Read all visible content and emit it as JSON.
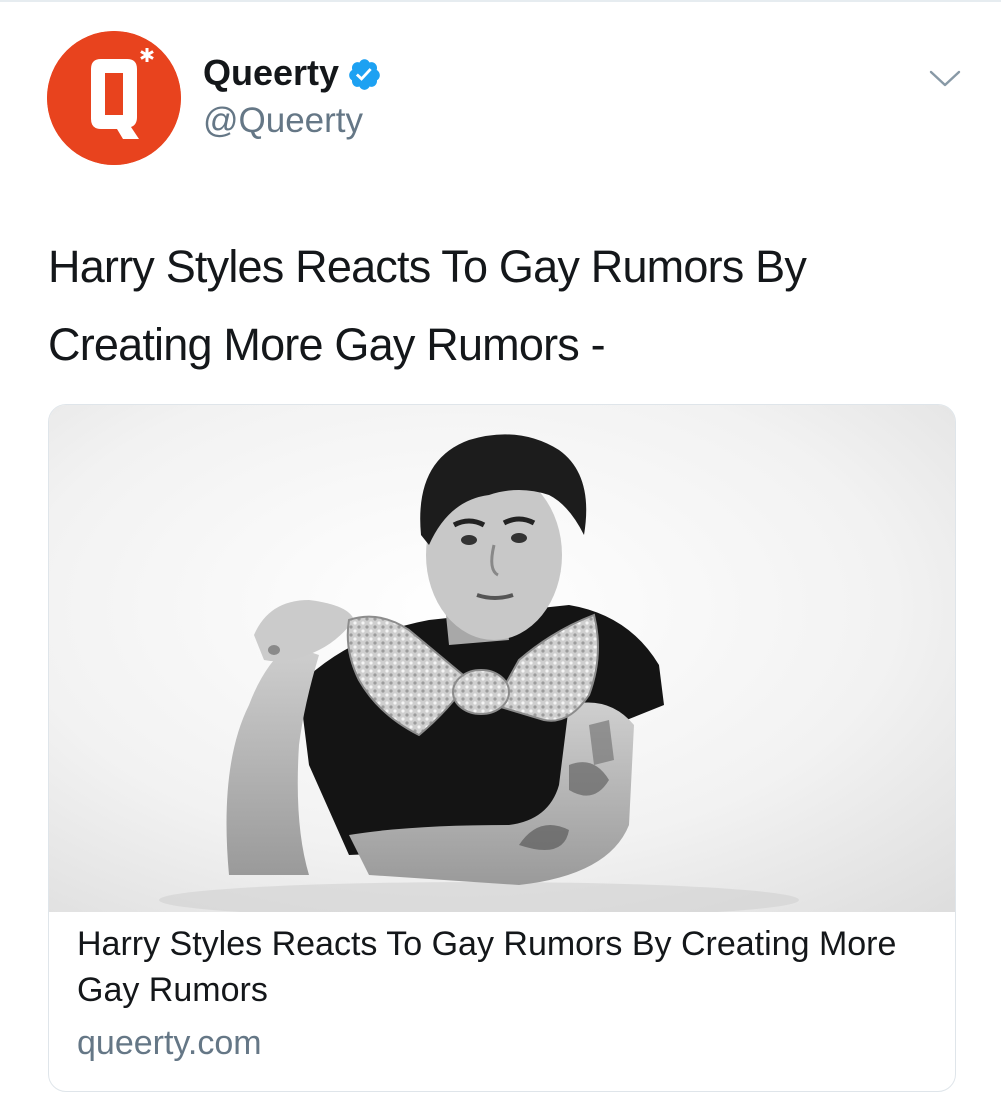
{
  "author": {
    "display_name": "Queerty",
    "handle": "@Queerty",
    "verified": true,
    "avatar_icon": "queerty-q-logo",
    "avatar_color": "#e8431e"
  },
  "tweet": {
    "text": "Harry Styles Reacts To Gay Rumors By Creating More Gay Rumors -"
  },
  "link_card": {
    "image": "black-and-white-photo-man-with-sequin-bow-tie",
    "title": "Harry Styles Reacts To Gay Rumors By Creating More Gay Rumors",
    "domain": "queerty.com"
  },
  "colors": {
    "text_primary": "#14171a",
    "text_secondary": "#657786",
    "verified_blue": "#1da1f2",
    "border": "#dfe5ea"
  },
  "icons": {
    "verified": "verified-badge-icon",
    "menu": "chevron-down-icon"
  }
}
